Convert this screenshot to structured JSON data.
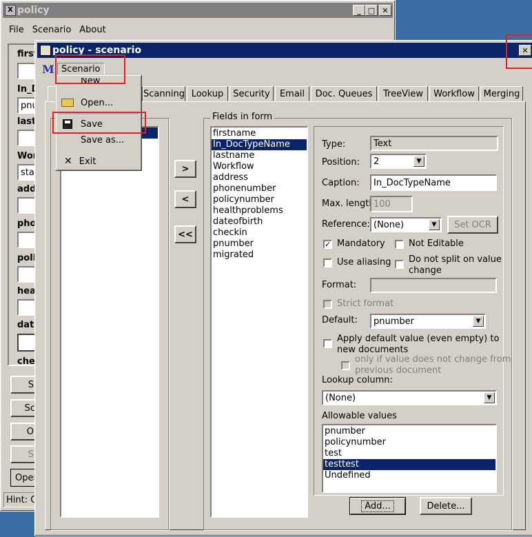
{
  "back_window": {
    "title": "policy",
    "menu": [
      "File",
      "Scenario",
      "About"
    ],
    "side_labels": [
      "first",
      "In_D",
      "last",
      "Wor",
      "add",
      "pho",
      "poli",
      "hea",
      "date",
      "che"
    ],
    "side_values": [
      "",
      "pnu",
      "",
      "star"
    ],
    "side_buttons": [
      "S",
      "Sc",
      "O",
      "S",
      "Oper"
    ],
    "status": "Hint: O"
  },
  "main_window": {
    "title": "policy - scenario",
    "menu_label": "Scenario",
    "tabs": [
      "Scanning",
      "Lookup",
      "Security",
      "Email",
      "Doc. Queues",
      "TreeView",
      "Workflow",
      "Merging"
    ],
    "fields_in_form_label": "Fields in form",
    "fields": [
      "firstname",
      "In_DocTypeName",
      "lastname",
      "Workflow",
      "address",
      "phonenumber",
      "policynumber",
      "healthproblems",
      "dateofbirth",
      "checkin",
      "pnumber",
      "migrated"
    ],
    "selected_field": "In_DocTypeName",
    "move_buttons": [
      ">",
      "<",
      "<<"
    ]
  },
  "dropdown_menu": {
    "items": [
      "New",
      "Open...",
      "Save",
      "Save as...",
      "Exit"
    ]
  },
  "properties": {
    "type_label": "Type:",
    "type_value": "Text",
    "position_label": "Position:",
    "position_value": "2",
    "caption_label": "Caption:",
    "caption_value": "In_DocTypeName",
    "maxlength_label": "Max. length:",
    "maxlength_value": "100",
    "reference_label": "Reference:",
    "reference_value": "(None)",
    "set_ocr_label": "Set OCR",
    "mandatory_label": "Mandatory",
    "mandatory_checked": true,
    "not_editable_label": "Not Editable",
    "use_aliasing_label": "Use aliasing",
    "no_split_label_1": "Do not split on value",
    "no_split_label_2": "change",
    "format_label": "Format:",
    "strict_format_label": "Strict format",
    "default_label": "Default:",
    "default_value": "pnumber",
    "apply_default_label_1": "Apply default value (even empty) to",
    "apply_default_label_2": "new documents",
    "only_if_label_1": "only if value does not change from",
    "only_if_label_2": "previous document",
    "lookup_column_label": "Lookup column:",
    "lookup_column_value": "(None)",
    "allowable_values_label": "Allowable values",
    "allowable_values": [
      "pnumber",
      "policynumber",
      "test",
      "testtest",
      "Undefined"
    ],
    "selected_allowable": "testtest",
    "add_button": "Add...",
    "delete_button": "Delete..."
  },
  "colors": {
    "desktop": "#3a6ea5",
    "active_title": "#0a246a",
    "highlight_box": "#e02020"
  }
}
